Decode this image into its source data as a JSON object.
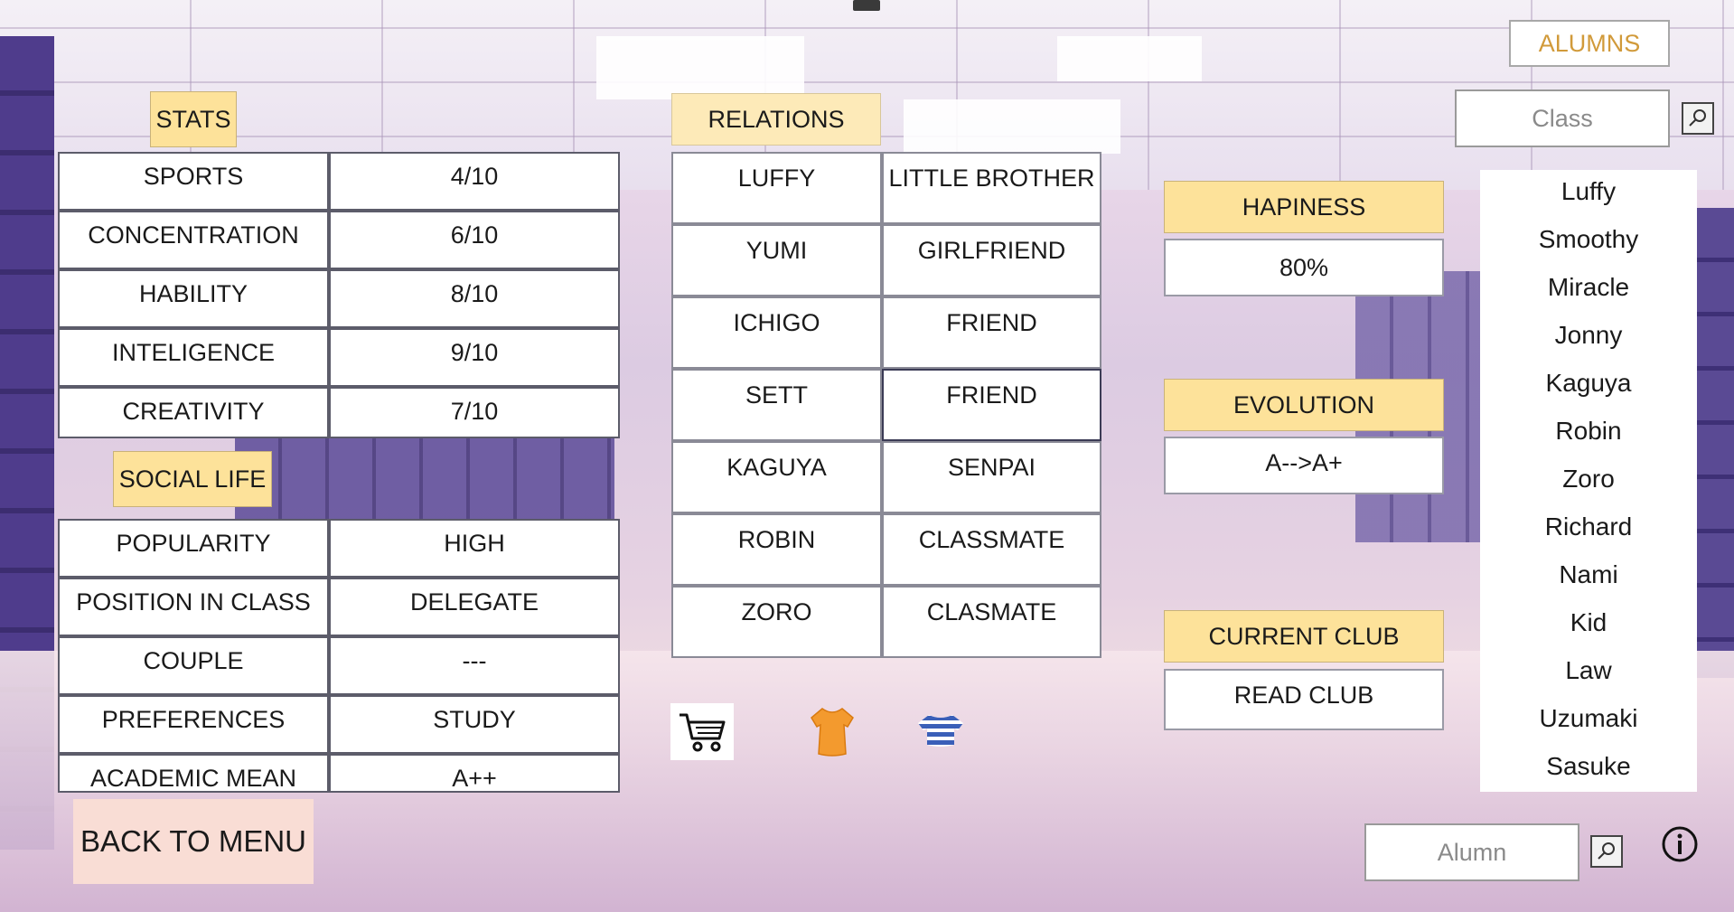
{
  "alumns_button": "ALUMNS",
  "class_search_placeholder": "Class",
  "alumn_search_placeholder": "Alumn",
  "back_button": "BACK TO MENU",
  "stats": {
    "title": "STATS",
    "rows": [
      {
        "label": "SPORTS",
        "value": "4/10"
      },
      {
        "label": "CONCENTRATION",
        "value": "6/10"
      },
      {
        "label": "HABILITY",
        "value": "8/10"
      },
      {
        "label": "INTELIGENCE",
        "value": "9/10"
      },
      {
        "label": "CREATIVITY",
        "value": "7/10"
      }
    ]
  },
  "social": {
    "title": "SOCIAL LIFE",
    "rows": [
      {
        "label": "POPULARITY",
        "value": "HIGH"
      },
      {
        "label": "POSITION IN CLASS",
        "value": "DELEGATE"
      },
      {
        "label": "COUPLE",
        "value": "---"
      },
      {
        "label": "PREFERENCES",
        "value": "STUDY"
      },
      {
        "label": "ACADEMIC MEAN",
        "value": "A++"
      }
    ]
  },
  "relations": {
    "title": "RELATIONS",
    "rows": [
      {
        "name": "LUFFY",
        "relation": "LITTLE BROTHER"
      },
      {
        "name": "YUMI",
        "relation": "GIRLFRIEND"
      },
      {
        "name": "ICHIGO",
        "relation": "FRIEND"
      },
      {
        "name": "SETT",
        "relation": "FRIEND"
      },
      {
        "name": "KAGUYA",
        "relation": "SENPAI"
      },
      {
        "name": "ROBIN",
        "relation": "CLASSMATE"
      },
      {
        "name": "ZORO",
        "relation": "CLASMATE"
      }
    ]
  },
  "happiness": {
    "title": "HAPINESS",
    "value": "80%"
  },
  "evolution": {
    "title": "EVOLUTION",
    "value": "A-->A+"
  },
  "club": {
    "title": "CURRENT CLUB",
    "value": "READ CLUB"
  },
  "alumns": [
    "Luffy",
    "Smoothy",
    "Miracle",
    "Jonny",
    "Kaguya",
    "Robin",
    "Zoro",
    "Richard",
    "Nami",
    "Kid",
    "Law",
    "Uzumaki",
    "Sasuke"
  ],
  "icons": {
    "cart": "shopping-cart-icon",
    "shirt": "orange-shirt-icon",
    "striped_shirt": "striped-shirt-icon",
    "info": "info-icon"
  },
  "colors": {
    "header": "#fde29a",
    "alumns_text": "#d19a3a",
    "back_bg": "#f9ddd5"
  }
}
